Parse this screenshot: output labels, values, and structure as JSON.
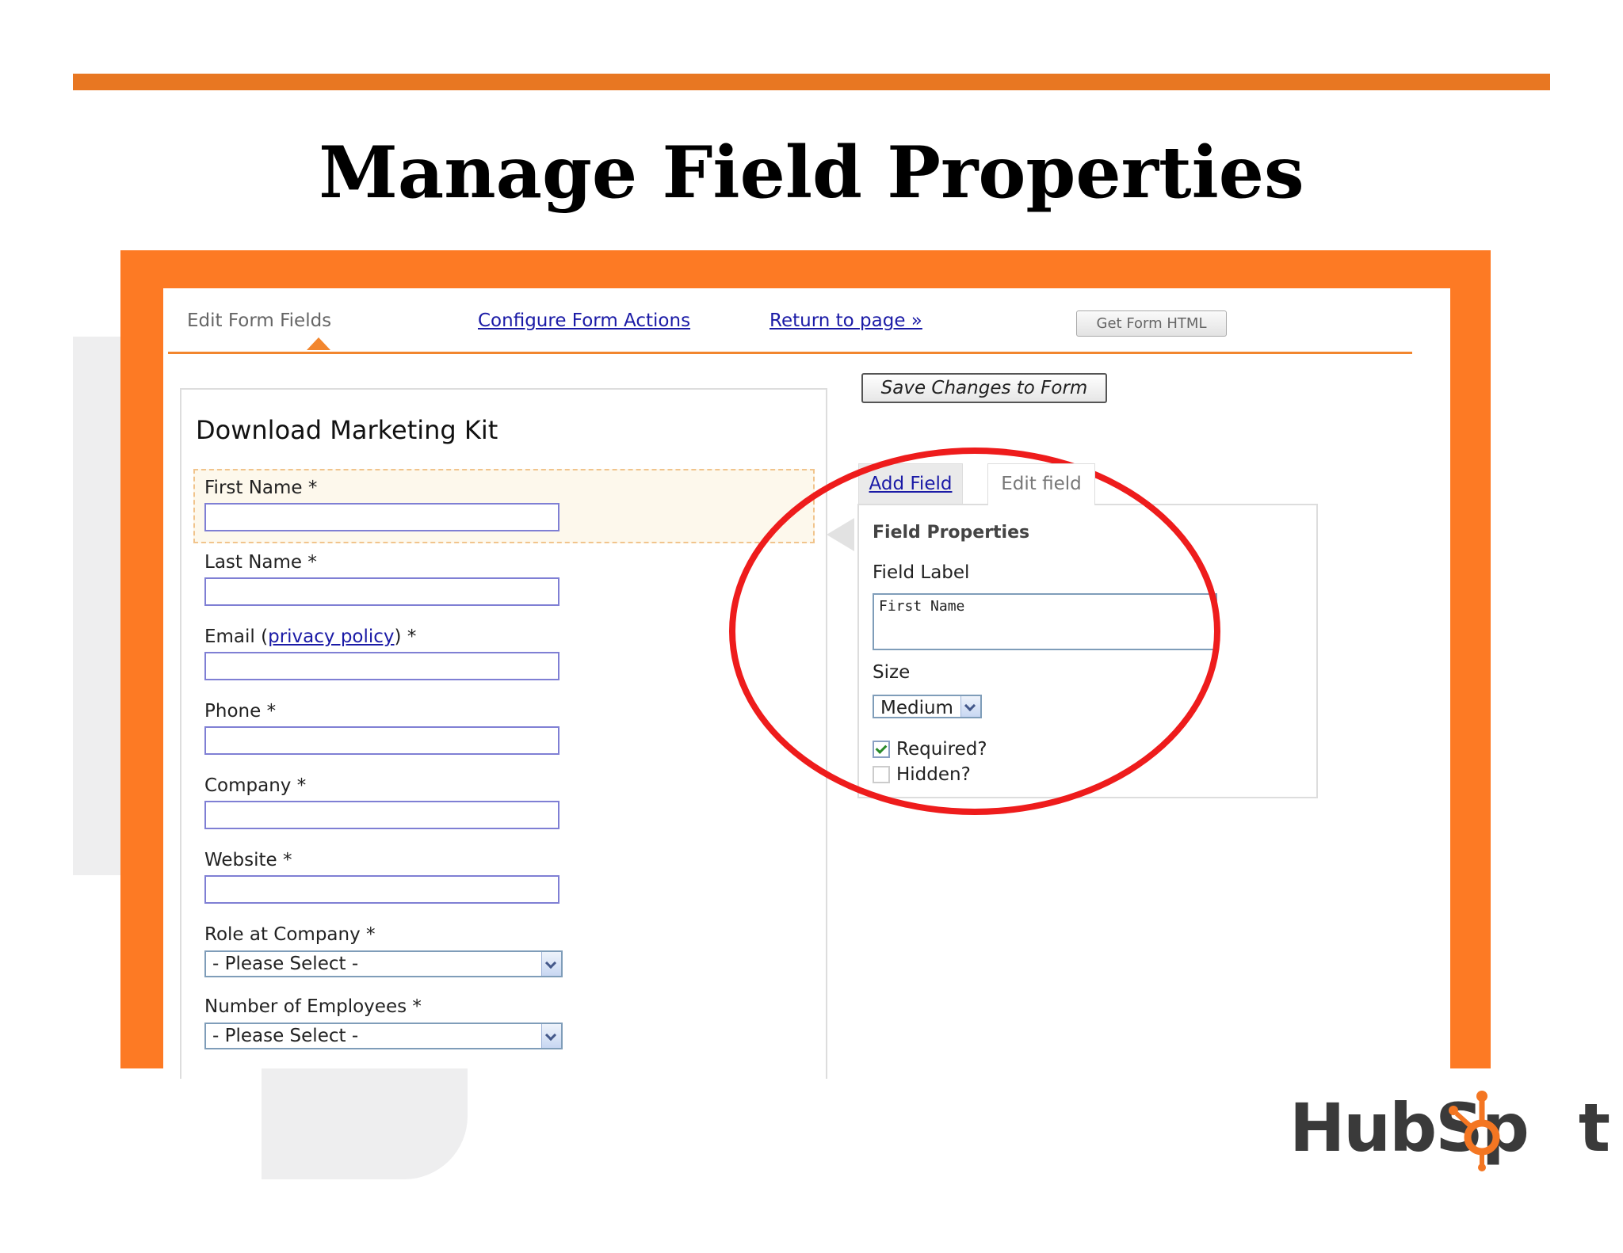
{
  "slide": {
    "title": "Manage Field Properties"
  },
  "tabs": {
    "current": "Edit Form Fields",
    "configure": "Configure Form Actions",
    "return": "Return to page »"
  },
  "buttons": {
    "get_html": "Get Form HTML",
    "save": "Save Changes to Form"
  },
  "form": {
    "title": "Download Marketing Kit",
    "fields": [
      {
        "label": "First Name",
        "required": "*"
      },
      {
        "label": "Last Name",
        "required": "*"
      },
      {
        "label_prefix": "Email (",
        "label_link": "privacy policy",
        "label_suffix": ")",
        "required": "*"
      },
      {
        "label": "Phone",
        "required": "*"
      },
      {
        "label": "Company",
        "required": "*"
      },
      {
        "label": "Website",
        "required": "*"
      },
      {
        "label": "Role at Company",
        "required": "*",
        "select_value": "- Please Select -"
      },
      {
        "label": "Number of Employees",
        "required": "*",
        "select_value": "- Please Select -"
      }
    ]
  },
  "editor": {
    "tab_add": "Add Field",
    "tab_edit": "Edit field",
    "heading": "Field Properties",
    "field_label_title": "Field Label",
    "field_label_value": "First Name",
    "size_title": "Size",
    "size_value": "Medium",
    "required_label": "Required?",
    "required_checked": true,
    "hidden_label": "Hidden?",
    "hidden_checked": false
  },
  "logo": {
    "text_left": "HubSp",
    "text_right": "t"
  },
  "colors": {
    "accent_orange": "#fd7a24",
    "highlight_circle": "#ee1c1c",
    "link_blue": "#1a1aa6"
  }
}
